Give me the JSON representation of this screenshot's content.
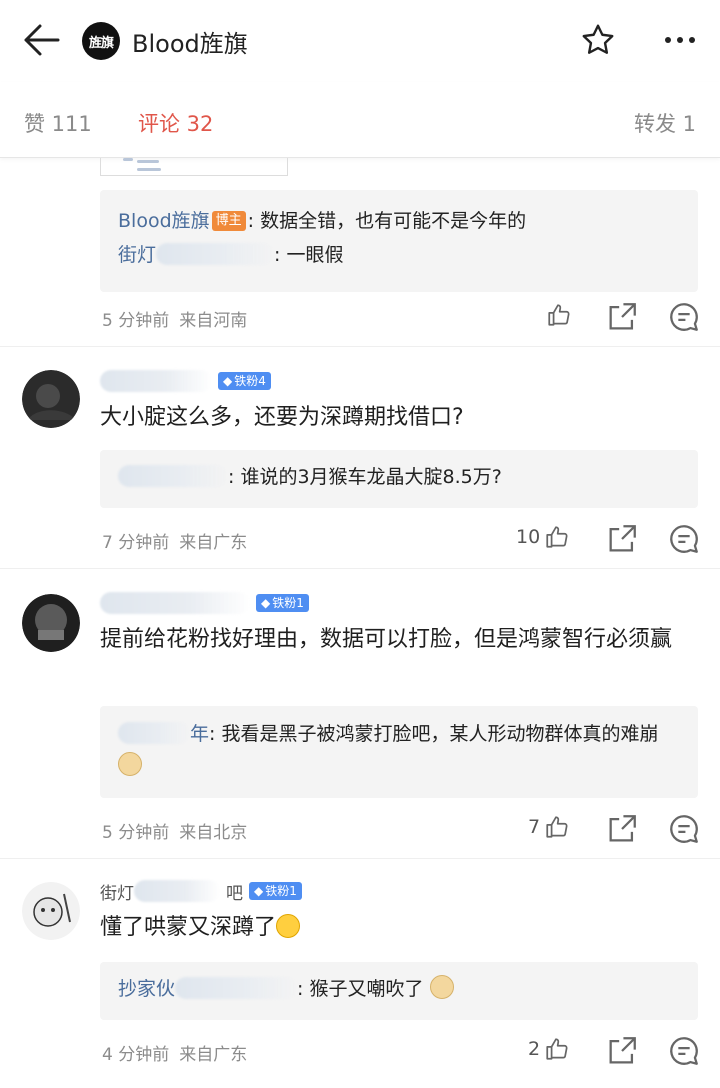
{
  "header": {
    "title": "Blood旌旗",
    "logo_text": "旌旗"
  },
  "tabs": {
    "likes": "赞 111",
    "comments": "评论 32",
    "reposts": "转发 1"
  },
  "comment0": {
    "reply_author": "Blood旌旗",
    "host_badge": "博主",
    "reply_text": ": 数据全错，也有可能不是今年的",
    "reply2_author_visible": "街灯",
    "reply2_text": ": 一眼假",
    "time": "5 分钟前",
    "location": "来自河南"
  },
  "comment1": {
    "fan_badge": "铁粉4",
    "text": "大小腚这么多，还要为深蹲期找借口?",
    "reply_text": ": 谁说的3月猴车龙晶大腚8.5万?",
    "time": "7 分钟前",
    "location": "来自广东",
    "likes": "10"
  },
  "comment2": {
    "fan_badge": "铁粉1",
    "text": "提前给花粉找好理由，数据可以打脸，但是鸿蒙智行必须赢",
    "reply_author_visible": "年",
    "reply_text": ": 我看是黑子被鸿蒙打脸吧，某人形动物群体真的难崩",
    "time": "5 分钟前",
    "location": "来自北京",
    "likes": "7"
  },
  "comment3": {
    "name_visible": "街灯",
    "name_tail": "吧",
    "fan_badge": "铁粉1",
    "text": "懂了哄蒙又深蹲了",
    "reply_author_visible": "抄家伙",
    "reply_text": ": 猴子又嘲吹了",
    "time": "4 分钟前",
    "location": "来自广东",
    "likes": "2"
  },
  "colors": {
    "accent_red": "#e0564a",
    "link_blue": "#4a6d9c",
    "fan_badge_blue": "#4f8ef2",
    "host_badge_orange": "#f08a3a"
  },
  "icons": [
    "back-arrow-icon",
    "star-icon",
    "more-icon",
    "thumbs-up-icon",
    "share-icon",
    "comment-icon",
    "doge-emoji",
    "laugh-cry-emoji"
  ]
}
